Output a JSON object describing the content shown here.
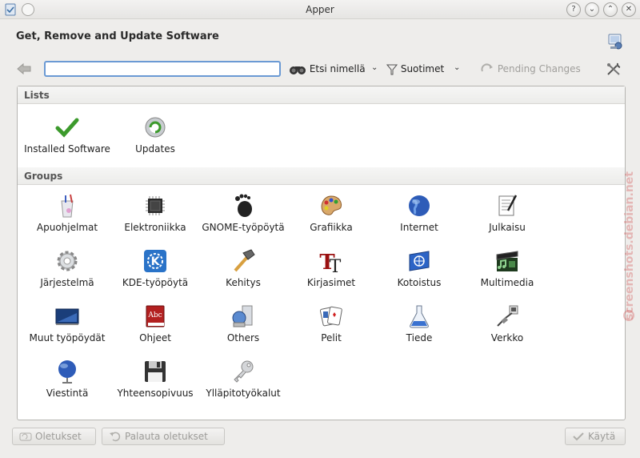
{
  "window": {
    "title": "Apper"
  },
  "header": {
    "title": "Get, Remove and Update Software"
  },
  "toolbar": {
    "search_value": "",
    "find_by_name": "Etsi nimellä",
    "filters": "Suotimet",
    "pending_changes": "Pending Changes"
  },
  "lists": {
    "heading": "Lists",
    "items": [
      {
        "label": "Installed Software",
        "icon": "checkmark-icon"
      },
      {
        "label": "Updates",
        "icon": "update-icon"
      }
    ]
  },
  "groups": {
    "heading": "Groups",
    "items": [
      {
        "label": "Apuohjelmat",
        "icon": "accessories-icon"
      },
      {
        "label": "Elektroniikka",
        "icon": "chip-icon"
      },
      {
        "label": "GNOME-työpöytä",
        "icon": "gnome-foot-icon"
      },
      {
        "label": "Grafiikka",
        "icon": "palette-icon"
      },
      {
        "label": "Internet",
        "icon": "globe-icon"
      },
      {
        "label": "Julkaisu",
        "icon": "publishing-icon"
      },
      {
        "label": "Järjestelmä",
        "icon": "gear-icon"
      },
      {
        "label": "KDE-työpöytä",
        "icon": "kde-icon"
      },
      {
        "label": "Kehitys",
        "icon": "hammer-icon"
      },
      {
        "label": "Kirjasimet",
        "icon": "font-icon"
      },
      {
        "label": "Kotoistus",
        "icon": "localization-icon"
      },
      {
        "label": "Multimedia",
        "icon": "multimedia-icon"
      },
      {
        "label": "Muut työpöydät",
        "icon": "desktop-icon"
      },
      {
        "label": "Ohjeet",
        "icon": "book-icon"
      },
      {
        "label": "Others",
        "icon": "others-icon"
      },
      {
        "label": "Pelit",
        "icon": "cards-icon"
      },
      {
        "label": "Tiede",
        "icon": "flask-icon"
      },
      {
        "label": "Verkko",
        "icon": "network-icon"
      },
      {
        "label": "Viestintä",
        "icon": "communication-icon"
      },
      {
        "label": "Yhteensopivuus",
        "icon": "floppy-icon"
      },
      {
        "label": "Ylläpitotyökalut",
        "icon": "key-icon"
      }
    ]
  },
  "footer": {
    "defaults": "Oletukset",
    "reset": "Palauta oletukset",
    "apply": "Käytä"
  },
  "watermark": "screenshots.debian.net"
}
